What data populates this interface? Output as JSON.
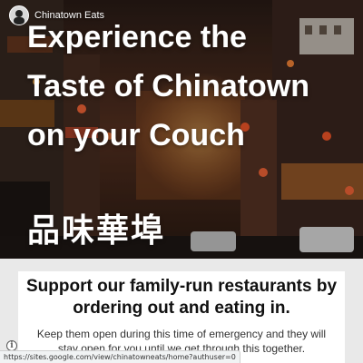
{
  "site": {
    "title": "Chinatown Eats",
    "avatar_icon": "avatar-icon"
  },
  "hero": {
    "title": "Experience the Taste of Chinatown on your Couch",
    "subtitle": "品味華埠"
  },
  "main": {
    "headline": "Support our family-run restaurants by ordering out and eating in.",
    "body": "Keep them open during this time of emergency and they will stay open for you until we get through this together."
  },
  "footer": {
    "info_icon": "info-icon",
    "status_url": "https://sites.google.com/view/chinatowneats/home?authuser=0"
  },
  "colors": {
    "hero_text": "#ffffff",
    "content_background": "#e9e9e9",
    "card_background": "#ffffff",
    "headline_text": "#111111"
  }
}
